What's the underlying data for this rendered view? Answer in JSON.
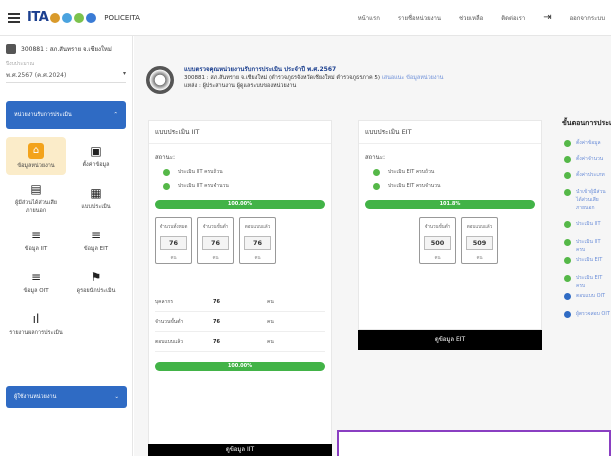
{
  "topbar": {
    "logo_text": "ITA",
    "brand": "POLICEITA",
    "nav": [
      "หน้าแรก",
      "รายชื่อหน่วยงาน",
      "ช่วยเหลือ",
      "ติดต่อเรา"
    ],
    "logout": "ออกจากระบบ"
  },
  "sidebar": {
    "school": "300881 : สภ.สันทราย จ.เชียงใหม่",
    "year_label": "ปีงบประมาณ",
    "year_value": "พ.ศ.2567 (ค.ศ.2024)",
    "section_label": "หน่วยงานรับการประเมิน",
    "tiles": [
      {
        "label": "ข้อมูลหน่วยงาน",
        "icon": "⌂"
      },
      {
        "label": "ตั้งค่าข้อมูล",
        "icon": "▣"
      },
      {
        "label": "ผู้มีส่วนได้ส่วนเสียภายนอก",
        "icon": "▤"
      },
      {
        "label": "แบบประเมิน",
        "icon": "▦"
      },
      {
        "label": "ข้อมูล IIT",
        "icon": "≡"
      },
      {
        "label": "ข้อมูล EIT",
        "icon": "≡"
      },
      {
        "label": "ข้อมูล OIT",
        "icon": "≡"
      },
      {
        "label": "ดูรอยนักประเมิน",
        "icon": "⚑"
      },
      {
        "label": "รายงานผลการประเมิน",
        "icon": "ıl"
      }
    ],
    "section2_label": "ผู้ใช้งานหน่วยงาน"
  },
  "header": {
    "title": "แบบตรวจคุณหน่วยงานรับการประเมิน ประจำปี พ.ศ.2567",
    "line1": "300881 : สภ.สันทราย จ.เชียงใหม่ (ตำรวจภูธรจังหวัดเชียงใหม่ ตำรวจภูธรภาค 5)",
    "line1_link": "เสนอแนะ ข้อมูลหน่วยงาน",
    "line2": "แหล่ง : ผู้ประสานงาน ผู้ดูแลระบบของหน่วยงาน"
  },
  "iit": {
    "title": "แบบประเมิน IIT",
    "status_label": "สถานะ:",
    "checks": [
      "ประเมิน IIT ครบถ้วน",
      "ประเมิน IIT ครบจำนวน"
    ],
    "progress": "100.00%",
    "boxes": [
      {
        "label": "จำนวนทั้งหมด",
        "value": "76",
        "unit": "คน"
      },
      {
        "label": "จำนวนขั้นต่ำ",
        "value": "76",
        "unit": "คน"
      },
      {
        "label": "ตอบแบบแล้ว",
        "value": "76",
        "unit": "คน"
      }
    ],
    "summary": [
      {
        "label": "บุคลากร",
        "value": "76",
        "unit": "คน"
      },
      {
        "label": "จำนวนขั้นต่ำ",
        "value": "76",
        "unit": "คน"
      },
      {
        "label": "ตอบแบบแล้ว",
        "value": "76",
        "unit": "คน"
      }
    ],
    "progress2": "100.00%",
    "button": "ดูข้อมูล IIT"
  },
  "eit": {
    "title": "แบบประเมิน EIT",
    "status_label": "สถานะ:",
    "checks": [
      "ประเมิน EIT ครบถ้วน",
      "ประเมิน EIT ครบจำนวน"
    ],
    "progress": "101.8%",
    "boxes": [
      {
        "label": "จำนวนขั้นต่ำ",
        "value": "500",
        "unit": "คน"
      },
      {
        "label": "ตอบแบบแล้ว",
        "value": "509",
        "unit": "คน"
      }
    ],
    "button": "ดูข้อมูล EIT"
  },
  "steps": {
    "title": "ขั้นตอนการประเมิน",
    "items": [
      {
        "label": "ตั้งค่าข้อมูล",
        "done": true
      },
      {
        "label": "ตั้งค่าจำนวน",
        "done": true
      },
      {
        "label": "ตั้งค่าประเภท",
        "done": true
      },
      {
        "label": "นำเข้าผู้มีส่วนได้ส่วนเสียภายนอก",
        "done": true
      },
      {
        "label": "ประเมิน IIT",
        "done": true
      },
      {
        "label": "ประเมิน IIT ครบ",
        "done": true
      },
      {
        "label": "ประเมิน EIT",
        "done": true
      },
      {
        "label": "ประเมิน EIT ครบ",
        "done": true
      },
      {
        "label": "ตอบแบบ OIT",
        "done": false
      },
      {
        "label": "ผู้ตรวจสอบ OIT",
        "done": false
      }
    ]
  },
  "colors": {
    "primary": "#2f6bc4",
    "success": "#42b347",
    "active_tile": "#fbecc9",
    "accent": "#8a3fc2"
  }
}
